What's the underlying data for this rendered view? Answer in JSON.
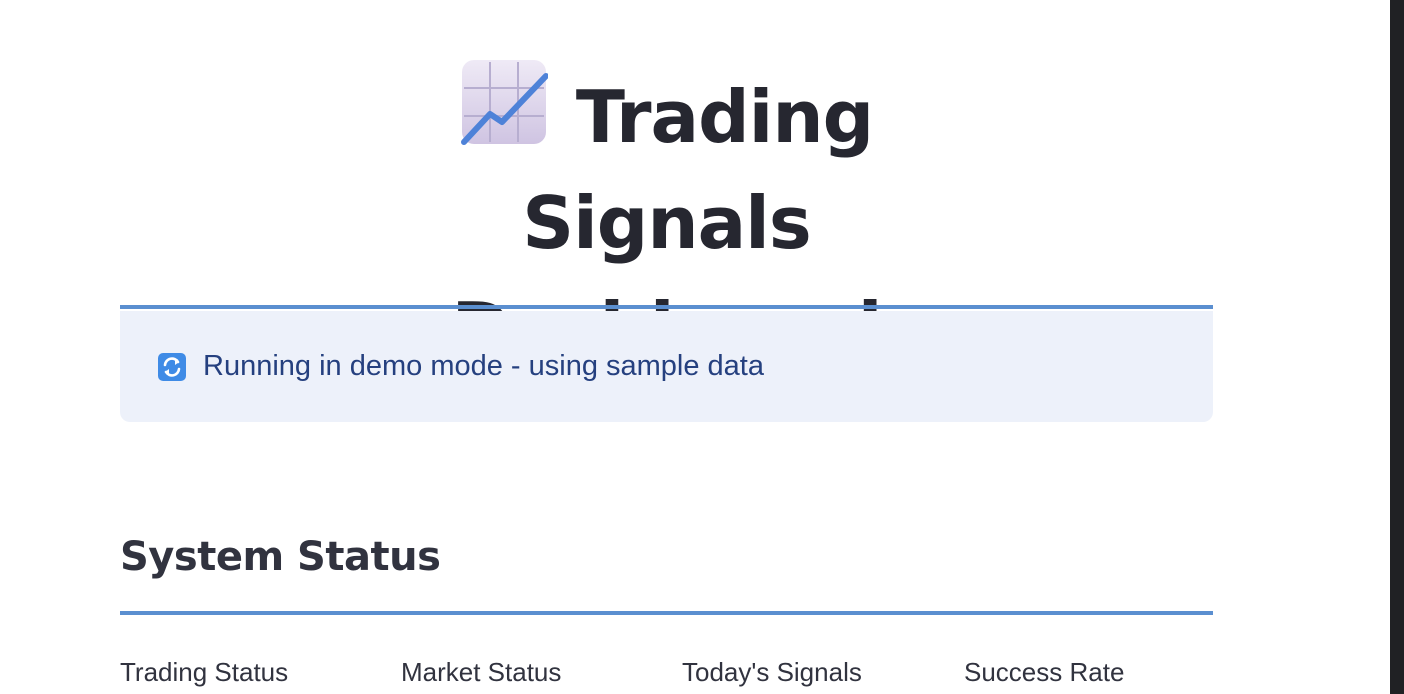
{
  "header": {
    "title_line1": "Trading Signals",
    "title_line2": "Dashboard",
    "title_icon": "chart-increasing-icon"
  },
  "alert": {
    "icon": "refresh-icon",
    "text": "Running in demo mode - using sample data"
  },
  "system_status": {
    "title": "System Status",
    "metrics": [
      {
        "label": "Trading Status"
      },
      {
        "label": "Market Status"
      },
      {
        "label": "Today's Signals"
      },
      {
        "label": "Success Rate"
      }
    ]
  },
  "colors": {
    "accent": "#5b8fd0",
    "alert_background": "#edf1fa",
    "alert_text": "#25407f",
    "heading": "#262730"
  }
}
